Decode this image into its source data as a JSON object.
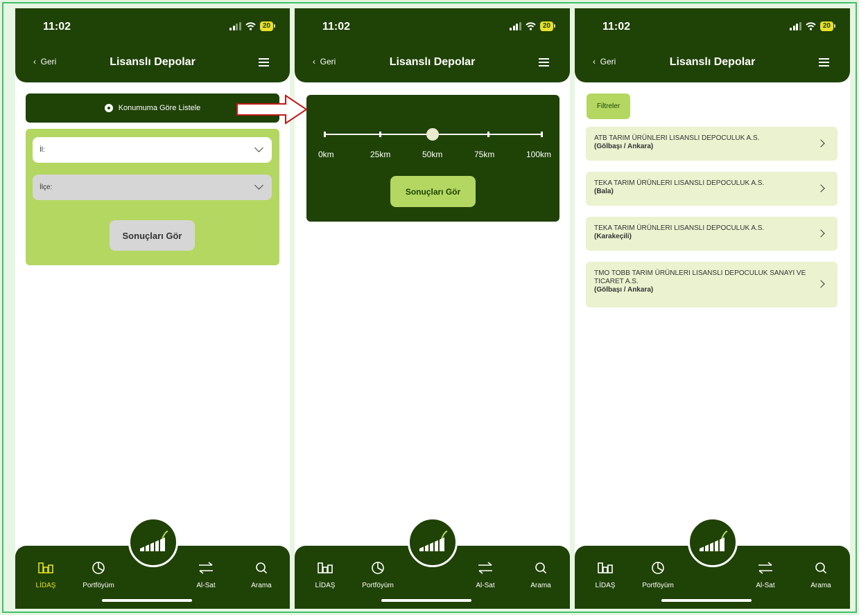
{
  "status": {
    "time": "11:02",
    "battery": "20"
  },
  "header": {
    "back_label": "Geri",
    "title": "Lisanslı Depolar"
  },
  "screen1": {
    "location_button": "Konumuma Göre Listele",
    "il_label": "İl:",
    "ilce_label": "İlçe:",
    "results_button": "Sonuçları Gör"
  },
  "screen2": {
    "distance_labels": [
      "0km",
      "25km",
      "50km",
      "75km",
      "100km"
    ],
    "selected_distance_km": 50,
    "results_button": "Sonuçları Gör"
  },
  "screen3": {
    "filter_chip": "Filtreler",
    "results": [
      {
        "name": "ATB TARIM ÜRÜNLERI LISANSLI DEPOCULUK A.S.",
        "location": "(Gölbaşı / Ankara)"
      },
      {
        "name": "TEKA TARIM ÜRÜNLERI LISANSLI DEPOCULUK A.S.",
        "location": "(Bala)"
      },
      {
        "name": "TEKA TARIM ÜRÜNLERI LISANSLI DEPOCULUK A.S.",
        "location": "(Karakeçili)"
      },
      {
        "name": "TMO TOBB TARIM ÜRÜNLERI LISANSLI DEPOCULUK SANAYI VE TICARET A.S.",
        "location": "(Gölbaşı / Ankara)"
      }
    ]
  },
  "tabs": {
    "lidas": "LİDAŞ",
    "portfoy": "Portföyüm",
    "alsat": "Al-Sat",
    "arama": "Arama"
  },
  "colors": {
    "primary": "#1f4206",
    "accent": "#b3d760",
    "active_tab": "#e3e024",
    "arrow": "#c01818"
  }
}
